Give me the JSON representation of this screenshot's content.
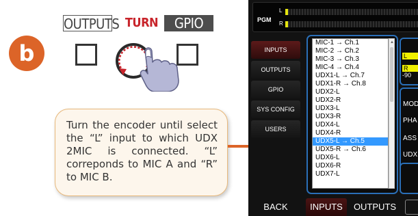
{
  "manual": {
    "step_letter": "b",
    "hardware_labels": {
      "outputs": "OUTPUTS",
      "turn": "TURN",
      "gpio": "GPIO"
    },
    "callout_text": "Turn the encoder until select the “L” input to which UDX 2MIC is connected. “L” correponds to MIC A and “R” to MIC B."
  },
  "device": {
    "meter": {
      "label": "PGM",
      "ch_l": "L",
      "ch_r": "R",
      "level_l": 0.02,
      "level_r": 0.02
    },
    "sidebar": [
      "INPUTS",
      "OUTPUTS",
      "GPIO",
      "SYS CONFIG",
      "USERS"
    ],
    "active_sidebar": "INPUTS",
    "input_list": {
      "items": [
        "MIC-1 → Ch.1",
        "MIC-2 → Ch.2",
        "MIC-3 → Ch.3",
        "MIC-4 → Ch.4",
        "UDX1-L → Ch.7",
        "UDX1-R → Ch.8",
        "UDX2-L",
        "UDX2-R",
        "UDX3-L",
        "UDX3-R",
        "UDX4-L",
        "UDX4-R",
        "UDX5-L → Ch.5",
        "UDX5-R → Ch.6",
        "UDX6-L",
        "UDX6-R",
        "UDX7-L"
      ],
      "selected": "UDX5-L → Ch.5"
    },
    "right_panel": {
      "level_l": "L",
      "level_r": "R",
      "level_value": "-90",
      "labels": [
        "MOD",
        "PHA",
        "ASS",
        "UDX"
      ]
    },
    "bottom_bar": {
      "back": "BACK",
      "inputs": "INPUTS",
      "outputs": "OUTPUTS",
      "extra": ""
    }
  },
  "colors": {
    "accent_orange": "#dc6428",
    "turn_red": "#c8242b",
    "list_selection": "#3399ff",
    "frame_blue": "#2a6fb8",
    "meter_yellow": "#e5e510"
  }
}
